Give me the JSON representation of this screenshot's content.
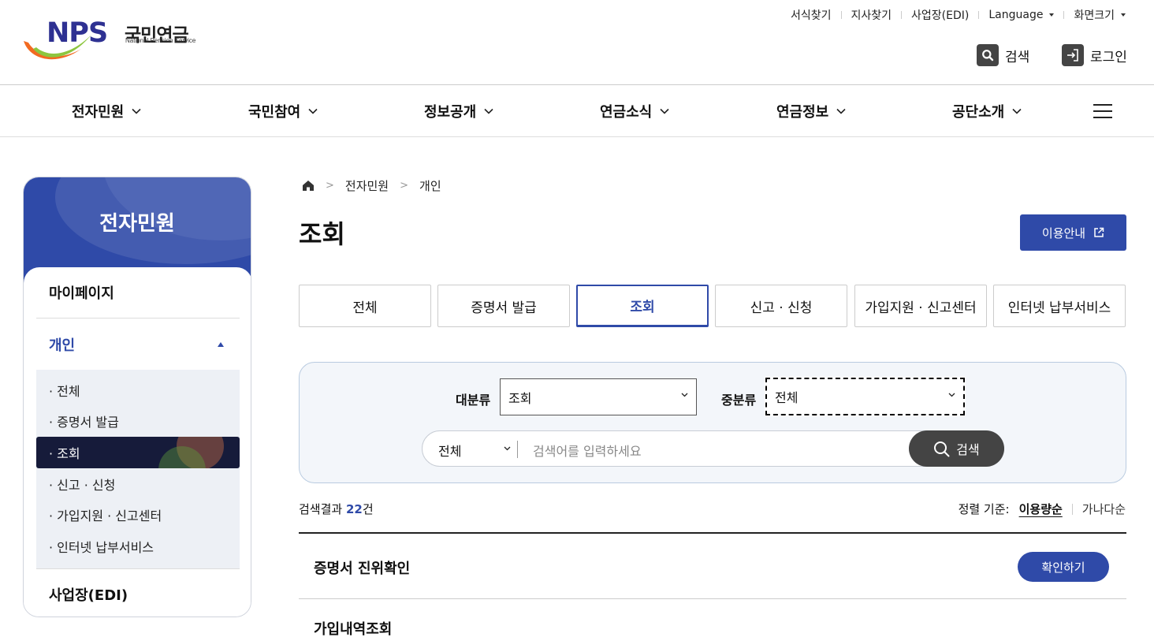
{
  "header": {
    "logo": {
      "brand": "NPS",
      "korean": "국민연금",
      "english": "National Pension Service"
    },
    "utility_links": [
      {
        "label": "서식찾기"
      },
      {
        "label": "지사찾기"
      },
      {
        "label": "사업장(EDI)"
      },
      {
        "label": "Language",
        "dropdown": true
      },
      {
        "label": "화면크기",
        "dropdown": true
      }
    ],
    "search_label": "검색",
    "login_label": "로그인"
  },
  "gnb": {
    "items": [
      {
        "label": "전자민원"
      },
      {
        "label": "국민참여"
      },
      {
        "label": "정보공개"
      },
      {
        "label": "연금소식"
      },
      {
        "label": "연금정보"
      },
      {
        "label": "공단소개"
      }
    ],
    "menu_icon": "hamburger-icon"
  },
  "sidebar": {
    "title": "전자민원",
    "items": [
      {
        "label": "마이페이지"
      },
      {
        "label": "개인",
        "expanded": true,
        "children": [
          {
            "label": "· 전체"
          },
          {
            "label": "· 증명서 발급"
          },
          {
            "label": "· 조회",
            "active": true
          },
          {
            "label": "· 신고 · 신청"
          },
          {
            "label": "· 가입지원 · 신고센터"
          },
          {
            "label": "· 인터넷 납부서비스"
          }
        ]
      },
      {
        "label": "사업장(EDI)"
      }
    ]
  },
  "breadcrumb": [
    "전자민원",
    "개인"
  ],
  "page": {
    "title": "조회",
    "guide_button": "이용안내"
  },
  "tabs": [
    {
      "label": "전체"
    },
    {
      "label": "증명서 발급"
    },
    {
      "label": "조회",
      "active": true
    },
    {
      "label": "신고 · 신청"
    },
    {
      "label": "가입지원 · 신고센터"
    },
    {
      "label": "인터넷 납부서비스"
    }
  ],
  "search": {
    "major_label": "대분류",
    "major_value": "조회",
    "middle_label": "중분류",
    "middle_value": "전체",
    "scope_value": "전체",
    "placeholder": "검색어를 입력하세요",
    "button_label": "검색"
  },
  "results": {
    "count_prefix": "검색결과 ",
    "count": "22",
    "count_suffix": "건",
    "sort_label": "정렬 기준:",
    "sort_options": [
      {
        "label": "이용량순",
        "active": true
      },
      {
        "label": "가나다순"
      }
    ],
    "items": [
      {
        "title": "증명서 진위확인",
        "action": "확인하기"
      },
      {
        "title": "가입내역조회"
      }
    ]
  },
  "colors": {
    "primary": "#2f4aa8",
    "dark_active": "#161b3a",
    "search_button": "#444444",
    "panel_bg": "#f3f6fa"
  }
}
